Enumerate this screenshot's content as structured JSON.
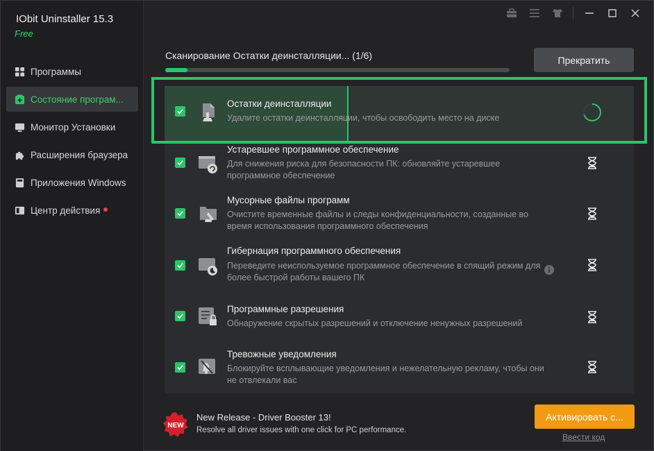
{
  "app": {
    "title": "IObit Uninstaller 15.3",
    "edition": "Free"
  },
  "sidebar": {
    "items": [
      {
        "label": "Программы",
        "icon": "grid-icon",
        "active": false
      },
      {
        "label": "Состояние програм...",
        "icon": "health-plus-icon",
        "active": true
      },
      {
        "label": "Монитор Установки",
        "icon": "monitor-icon",
        "active": false
      },
      {
        "label": "Расширения браузера",
        "icon": "puzzle-icon",
        "active": false
      },
      {
        "label": "Приложения Windows",
        "icon": "windows-app-icon",
        "active": false
      },
      {
        "label": "Центр действия",
        "icon": "action-center-icon",
        "active": false,
        "notification_dot": true
      }
    ]
  },
  "titlebar": {
    "icons": [
      "toolbox-icon",
      "menu-icon",
      "skin-icon",
      "minimize-icon",
      "maximize-icon",
      "close-icon"
    ]
  },
  "scan": {
    "title": "Сканирование Остатки деинсталляции... (1/6)",
    "progress": 0.065,
    "stop_label": "Прекратить"
  },
  "tasks": [
    {
      "title": "Остатки деинсталляции",
      "desc": "Удалите остатки деинсталляции, чтобы освободить место на диске",
      "checked": true,
      "status": "scanning",
      "icon": "leftover-files-icon"
    },
    {
      "title": "Устаревшее программное обеспечение",
      "desc": "Для снижения риска для безопасности ПК: обновляйте устаревшее программное обеспечение",
      "checked": true,
      "status": "waiting",
      "icon": "outdated-software-icon"
    },
    {
      "title": "Мусорные файлы программ",
      "desc": "Очистите временные файлы и следы конфиденциальности, созданные во время использования программного обеспечения",
      "checked": true,
      "status": "waiting",
      "icon": "junk-files-icon"
    },
    {
      "title": "Гибернация программного обеспечения",
      "desc": "Переведите неиспользуемое программное обеспечение в спящий режим для более быстрой работы вашего ПК",
      "checked": true,
      "status": "waiting",
      "icon": "hibernate-icon",
      "info": true
    },
    {
      "title": "Программные разрешения",
      "desc": "Обнаружение скрытых разрешений и отключение ненужных разрешений",
      "checked": true,
      "status": "waiting",
      "icon": "permissions-icon"
    },
    {
      "title": "Тревожные уведомления",
      "desc": "Блокируйте всплывающие уведомления и нежелательную рекламу, чтобы они не отвлекали вас",
      "checked": true,
      "status": "waiting",
      "icon": "notification-off-icon"
    }
  ],
  "footer": {
    "badge": "NEW",
    "promo_title": "New Release - Driver Booster 13!",
    "promo_desc": "Resolve all driver issues with one click for PC performance.",
    "activate_label": "Активировать с...",
    "enter_code_label": "Ввести код"
  },
  "colors": {
    "accent_green": "#2ec36a",
    "activate_orange": "#f29a12",
    "highlight_green": "#2cc46a",
    "notification_red": "#e8434d"
  }
}
